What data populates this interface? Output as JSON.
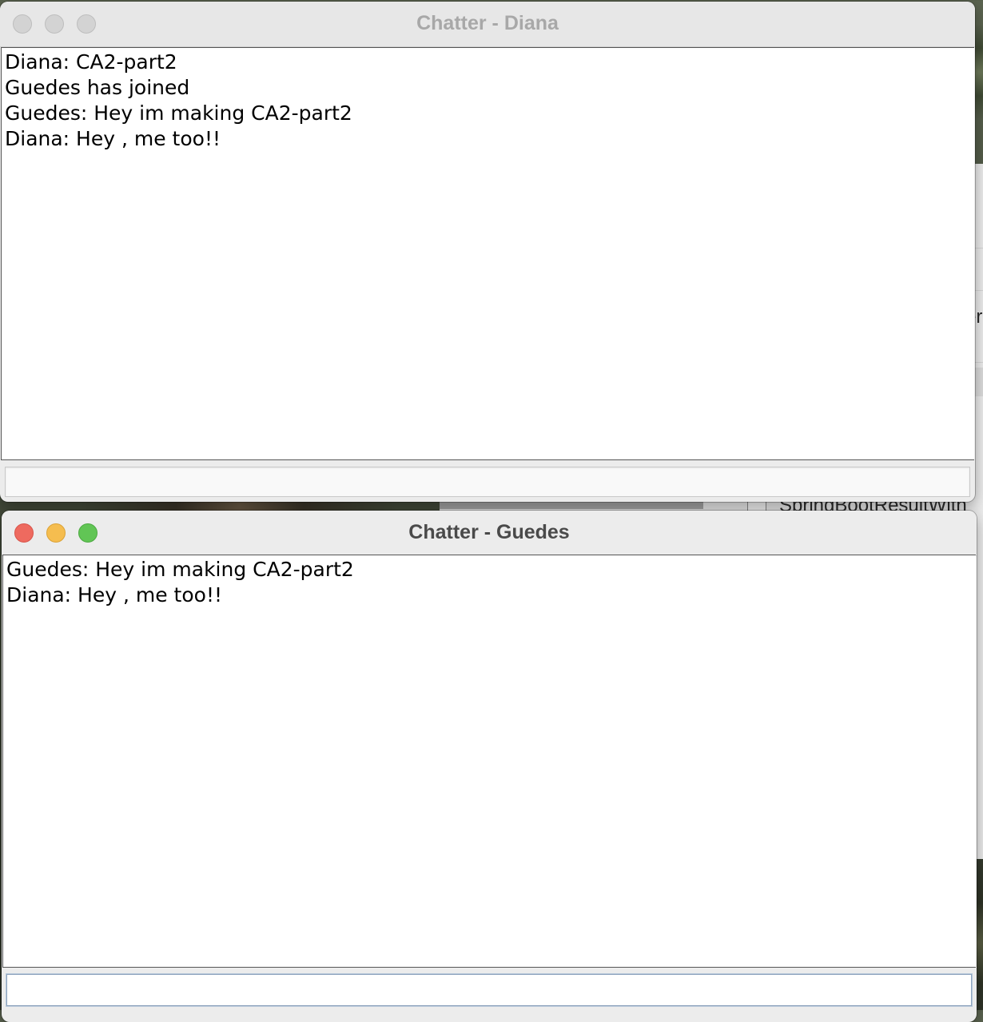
{
  "background_window": {
    "visible_text": "SpringBootResultWith",
    "edge_text": "er"
  },
  "windows": [
    {
      "title": "Chatter - Diana",
      "state": "inactive",
      "messages": [
        "Diana: CA2-part2",
        "Guedes has joined",
        "Guedes: Hey im making CA2-part2",
        "Diana: Hey , me too!!"
      ],
      "input_value": ""
    },
    {
      "title": "Chatter - Guedes",
      "state": "active",
      "messages": [
        "Guedes: Hey im making CA2-part2",
        "Diana: Hey , me too!!"
      ],
      "input_value": ""
    }
  ],
  "colors": {
    "close": "#ee6a5f",
    "minimize": "#f5bd4f",
    "maximize": "#61c555",
    "inactive_button": "#d3d3d3"
  }
}
